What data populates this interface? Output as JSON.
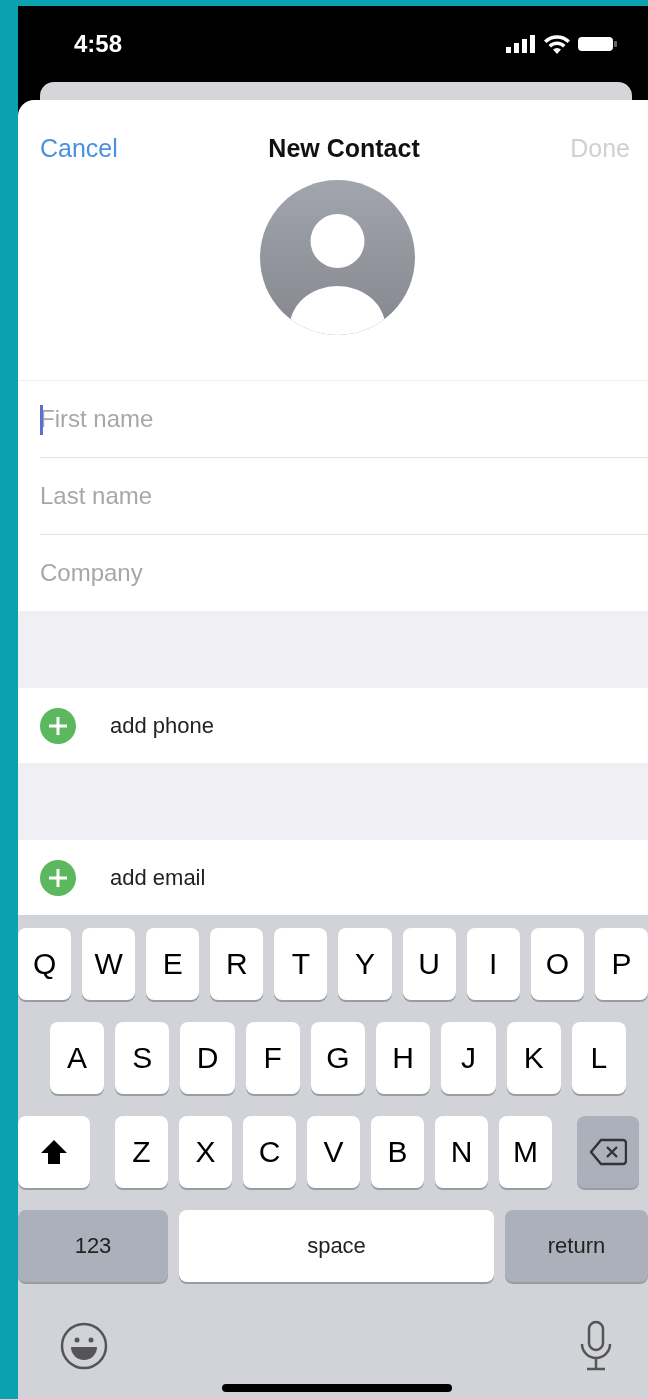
{
  "status_bar": {
    "time": "4:58"
  },
  "nav": {
    "cancel": "Cancel",
    "title": "New Contact",
    "done": "Done",
    "done_disabled": true
  },
  "fields": [
    {
      "placeholder": "First name",
      "focused": true
    },
    {
      "placeholder": "Last name",
      "focused": false
    },
    {
      "placeholder": "Company",
      "focused": false
    }
  ],
  "add_rows": [
    {
      "label": "add phone"
    },
    {
      "label": "add email"
    }
  ],
  "keyboard": {
    "rows": [
      {
        "keys": [
          {
            "kind": "letter",
            "label": "Q"
          },
          {
            "kind": "letter",
            "label": "W"
          },
          {
            "kind": "letter",
            "label": "E"
          },
          {
            "kind": "letter",
            "label": "R"
          },
          {
            "kind": "letter",
            "label": "T"
          },
          {
            "kind": "letter",
            "label": "Y"
          },
          {
            "kind": "letter",
            "label": "U"
          },
          {
            "kind": "letter",
            "label": "I"
          },
          {
            "kind": "letter",
            "label": "O"
          },
          {
            "kind": "letter",
            "label": "P"
          }
        ]
      },
      {
        "keys": [
          {
            "kind": "letter",
            "label": "A"
          },
          {
            "kind": "letter",
            "label": "S"
          },
          {
            "kind": "letter",
            "label": "D"
          },
          {
            "kind": "letter",
            "label": "F"
          },
          {
            "kind": "letter",
            "label": "G"
          },
          {
            "kind": "letter",
            "label": "H"
          },
          {
            "kind": "letter",
            "label": "J"
          },
          {
            "kind": "letter",
            "label": "K"
          },
          {
            "kind": "letter",
            "label": "L"
          }
        ]
      },
      {
        "keys": [
          {
            "kind": "shift"
          },
          {
            "kind": "letter",
            "label": "Z"
          },
          {
            "kind": "letter",
            "label": "X"
          },
          {
            "kind": "letter",
            "label": "C"
          },
          {
            "kind": "letter",
            "label": "V"
          },
          {
            "kind": "letter",
            "label": "B"
          },
          {
            "kind": "letter",
            "label": "N"
          },
          {
            "kind": "letter",
            "label": "M"
          },
          {
            "kind": "delete"
          }
        ]
      }
    ],
    "bottom_keys": [
      {
        "kind": "numbers",
        "label": "123"
      },
      {
        "kind": "space",
        "label": "space"
      },
      {
        "kind": "return",
        "label": "return"
      }
    ]
  }
}
